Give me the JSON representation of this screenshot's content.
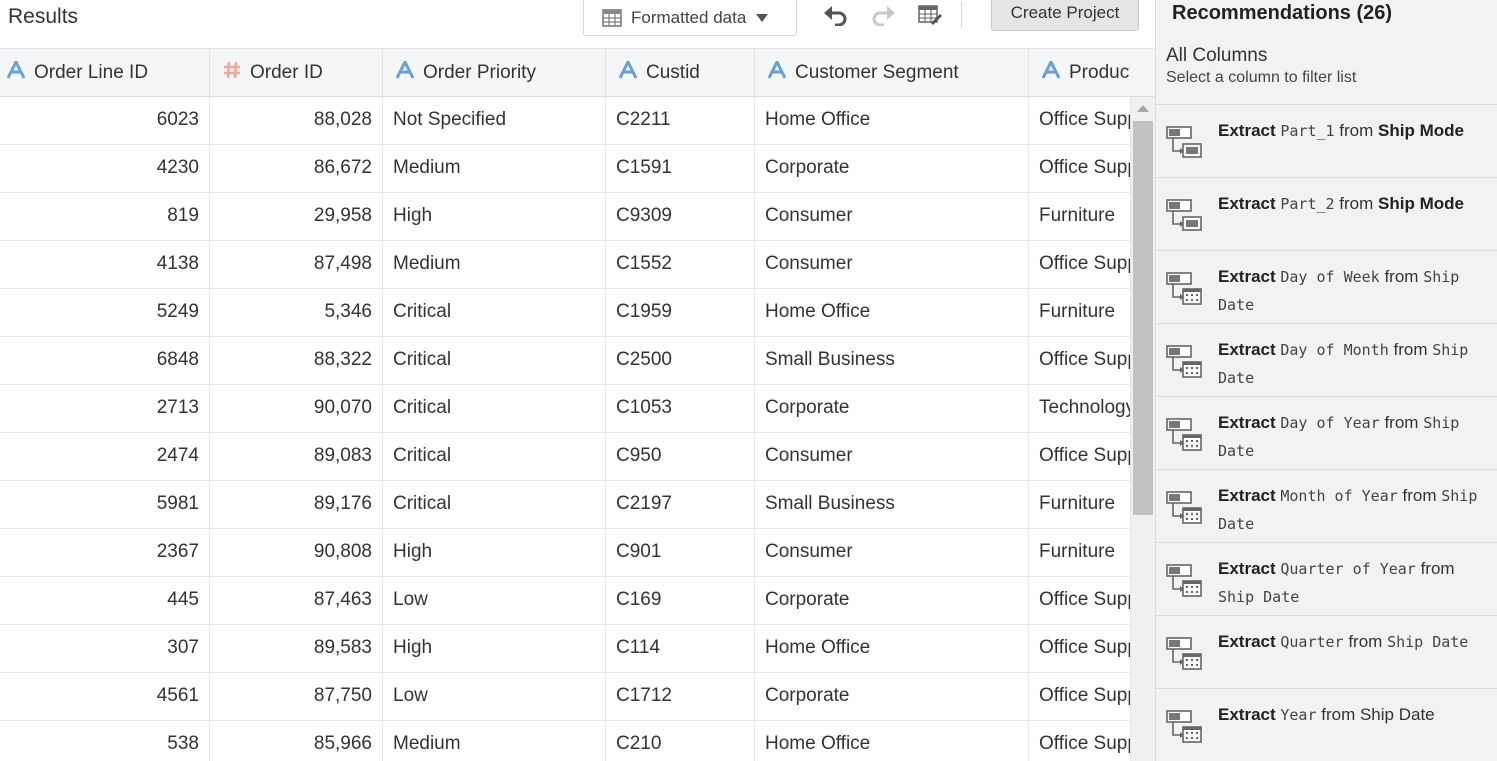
{
  "toolbar": {
    "results_title": "Results",
    "formatted_label": "Formatted data",
    "create_project": "Create Project",
    "undo_icon": "undo-icon",
    "redo_icon": "redo-icon",
    "edit_table_icon": "table-edit-icon"
  },
  "columns": [
    {
      "label": "Order Line ID",
      "type_icon": "A",
      "type": "text"
    },
    {
      "label": "Order ID",
      "type_icon": "#",
      "type": "number"
    },
    {
      "label": "Order Priority",
      "type_icon": "A",
      "type": "text"
    },
    {
      "label": "Custid",
      "type_icon": "A",
      "type": "text"
    },
    {
      "label": "Customer Segment",
      "type_icon": "A",
      "type": "text"
    },
    {
      "label": "Product",
      "type_icon": "A",
      "type": "text"
    }
  ],
  "rows": [
    [
      "6023",
      "88,028",
      "Not Specified",
      "C2211",
      "Home Office",
      "Office Supplies"
    ],
    [
      "4230",
      "86,672",
      "Medium",
      "C1591",
      "Corporate",
      "Office Supplies"
    ],
    [
      "819",
      "29,958",
      "High",
      "C9309",
      "Consumer",
      "Furniture"
    ],
    [
      "4138",
      "87,498",
      "Medium",
      "C1552",
      "Consumer",
      "Office Supplies"
    ],
    [
      "5249",
      "5,346",
      "Critical",
      "C1959",
      "Home Office",
      "Furniture"
    ],
    [
      "6848",
      "88,322",
      "Critical",
      "C2500",
      "Small Business",
      "Office Supplies"
    ],
    [
      "2713",
      "90,070",
      "Critical",
      "C1053",
      "Corporate",
      "Technology"
    ],
    [
      "2474",
      "89,083",
      "Critical",
      "C950",
      "Consumer",
      "Office Supplies"
    ],
    [
      "5981",
      "89,176",
      "Critical",
      "C2197",
      "Small Business",
      "Furniture"
    ],
    [
      "2367",
      "90,808",
      "High",
      "C901",
      "Consumer",
      "Furniture"
    ],
    [
      "445",
      "87,463",
      "Low",
      "C169",
      "Corporate",
      "Office Supplies"
    ],
    [
      "307",
      "89,583",
      "High",
      "C114",
      "Home Office",
      "Office Supplies"
    ],
    [
      "4561",
      "87,750",
      "Low",
      "C1712",
      "Corporate",
      "Office Supplies"
    ],
    [
      "538",
      "85,966",
      "Medium",
      "C210",
      "Home Office",
      "Office Supplies"
    ]
  ],
  "sidebar": {
    "title": "Recommendations (26)",
    "subtitle": "All Columns",
    "hint": "Select a column to filter list",
    "items": [
      {
        "action": "Extract",
        "part": "Part_1",
        "from": "from",
        "source": "Ship Mode",
        "source_style": "bold"
      },
      {
        "action": "Extract",
        "part": "Part_2",
        "from": "from",
        "source": "Ship Mode",
        "source_style": "bold"
      },
      {
        "action": "Extract",
        "part": "Day of Week",
        "from": "from",
        "source": "Ship Date",
        "source_style": "mono"
      },
      {
        "action": "Extract",
        "part": "Day of Month",
        "from": "from",
        "source": "Ship Date",
        "source_style": "mono"
      },
      {
        "action": "Extract",
        "part": "Day of Year",
        "from": "from",
        "source": "Ship Date",
        "source_style": "mono"
      },
      {
        "action": "Extract",
        "part": "Month of Year",
        "from": "from",
        "source": "Ship Date",
        "source_style": "mono"
      },
      {
        "action": "Extract",
        "part": "Quarter of Year",
        "from": "from",
        "source": "Ship Date",
        "source_style": "mono"
      },
      {
        "action": "Extract",
        "part": "Quarter",
        "from": "from",
        "source": "Ship Date",
        "source_style": "mono"
      },
      {
        "action": "Extract",
        "part": "Year",
        "from": "from",
        "source": "Ship Date",
        "source_style": "plain"
      }
    ]
  },
  "colors": {
    "text_type_icon": "#6a9fd8",
    "number_type_icon": "#f0a79a",
    "header_bg": "#f4f6f8",
    "sidebar_bg": "#f0f2f4"
  }
}
